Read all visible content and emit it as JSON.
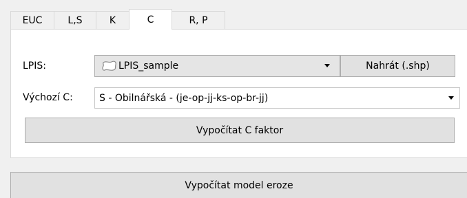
{
  "tabs": [
    {
      "label": "EUC"
    },
    {
      "label": "L,S"
    },
    {
      "label": "K"
    },
    {
      "label": "C"
    },
    {
      "label": "R, P"
    }
  ],
  "active_tab": "C",
  "lpis": {
    "label": "LPIS:",
    "selected_value": "LPIS_sample",
    "layer_icon": "polygon-layer-icon",
    "load_button_label": "Nahrát (.shp)"
  },
  "default_c": {
    "label": "Výchozí C:",
    "selected_value": "S - Obilnářská - (je-op-jj-ks-op-br-jj)"
  },
  "compute_c_button_label": "Vypočítat C faktor",
  "compute_model_button_label": "Vypočítat model eroze"
}
